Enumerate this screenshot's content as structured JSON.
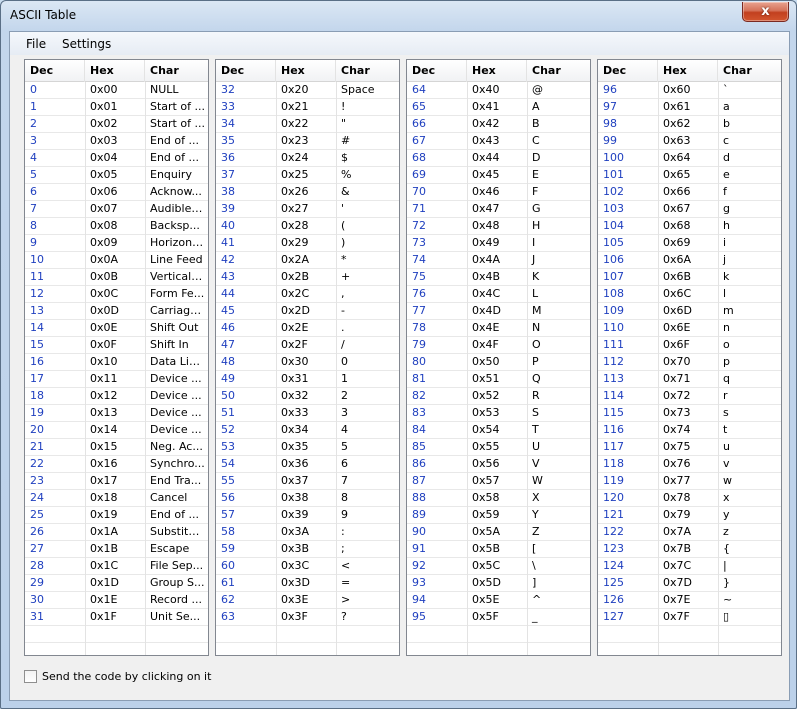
{
  "window": {
    "title": "ASCII Table",
    "close_label": "x"
  },
  "menu": [
    "File",
    "Settings"
  ],
  "columns": [
    "Dec",
    "Hex",
    "Char"
  ],
  "tables": [
    {
      "rows": [
        [
          "0",
          "0x00",
          "NULL"
        ],
        [
          "1",
          "0x01",
          "Start of ..."
        ],
        [
          "2",
          "0x02",
          "Start of ..."
        ],
        [
          "3",
          "0x03",
          "End of ..."
        ],
        [
          "4",
          "0x04",
          "End of ..."
        ],
        [
          "5",
          "0x05",
          "Enquiry"
        ],
        [
          "6",
          "0x06",
          "Acknow..."
        ],
        [
          "7",
          "0x07",
          "Audible ..."
        ],
        [
          "8",
          "0x08",
          "Backsp..."
        ],
        [
          "9",
          "0x09",
          "Horizont..."
        ],
        [
          "10",
          "0x0A",
          "Line Feed"
        ],
        [
          "11",
          "0x0B",
          "Vertical ..."
        ],
        [
          "12",
          "0x0C",
          "Form Fe..."
        ],
        [
          "13",
          "0x0D",
          "Carriage..."
        ],
        [
          "14",
          "0x0E",
          "Shift Out"
        ],
        [
          "15",
          "0x0F",
          "Shift In"
        ],
        [
          "16",
          "0x10",
          "Data Lin..."
        ],
        [
          "17",
          "0x11",
          "Device ..."
        ],
        [
          "18",
          "0x12",
          "Device ..."
        ],
        [
          "19",
          "0x13",
          "Device ..."
        ],
        [
          "20",
          "0x14",
          "Device ..."
        ],
        [
          "21",
          "0x15",
          "Neg. Ac..."
        ],
        [
          "22",
          "0x16",
          "Synchro..."
        ],
        [
          "23",
          "0x17",
          "End Tra..."
        ],
        [
          "24",
          "0x18",
          "Cancel"
        ],
        [
          "25",
          "0x19",
          "End of ..."
        ],
        [
          "26",
          "0x1A",
          "Substitu..."
        ],
        [
          "27",
          "0x1B",
          "Escape"
        ],
        [
          "28",
          "0x1C",
          "File Sep..."
        ],
        [
          "29",
          "0x1D",
          "Group S..."
        ],
        [
          "30",
          "0x1E",
          "Record ..."
        ],
        [
          "31",
          "0x1F",
          "Unit Se..."
        ]
      ]
    },
    {
      "rows": [
        [
          "32",
          "0x20",
          "Space"
        ],
        [
          "33",
          "0x21",
          "!"
        ],
        [
          "34",
          "0x22",
          "\""
        ],
        [
          "35",
          "0x23",
          "#"
        ],
        [
          "36",
          "0x24",
          "$"
        ],
        [
          "37",
          "0x25",
          "%"
        ],
        [
          "38",
          "0x26",
          "&"
        ],
        [
          "39",
          "0x27",
          "'"
        ],
        [
          "40",
          "0x28",
          "("
        ],
        [
          "41",
          "0x29",
          ")"
        ],
        [
          "42",
          "0x2A",
          "*"
        ],
        [
          "43",
          "0x2B",
          "+"
        ],
        [
          "44",
          "0x2C",
          ","
        ],
        [
          "45",
          "0x2D",
          "-"
        ],
        [
          "46",
          "0x2E",
          "."
        ],
        [
          "47",
          "0x2F",
          "/"
        ],
        [
          "48",
          "0x30",
          "0"
        ],
        [
          "49",
          "0x31",
          "1"
        ],
        [
          "50",
          "0x32",
          "2"
        ],
        [
          "51",
          "0x33",
          "3"
        ],
        [
          "52",
          "0x34",
          "4"
        ],
        [
          "53",
          "0x35",
          "5"
        ],
        [
          "54",
          "0x36",
          "6"
        ],
        [
          "55",
          "0x37",
          "7"
        ],
        [
          "56",
          "0x38",
          "8"
        ],
        [
          "57",
          "0x39",
          "9"
        ],
        [
          "58",
          "0x3A",
          ":"
        ],
        [
          "59",
          "0x3B",
          ";"
        ],
        [
          "60",
          "0x3C",
          "<"
        ],
        [
          "61",
          "0x3D",
          "="
        ],
        [
          "62",
          "0x3E",
          ">"
        ],
        [
          "63",
          "0x3F",
          "?"
        ]
      ]
    },
    {
      "rows": [
        [
          "64",
          "0x40",
          "@"
        ],
        [
          "65",
          "0x41",
          "A"
        ],
        [
          "66",
          "0x42",
          "B"
        ],
        [
          "67",
          "0x43",
          "C"
        ],
        [
          "68",
          "0x44",
          "D"
        ],
        [
          "69",
          "0x45",
          "E"
        ],
        [
          "70",
          "0x46",
          "F"
        ],
        [
          "71",
          "0x47",
          "G"
        ],
        [
          "72",
          "0x48",
          "H"
        ],
        [
          "73",
          "0x49",
          "I"
        ],
        [
          "74",
          "0x4A",
          "J"
        ],
        [
          "75",
          "0x4B",
          "K"
        ],
        [
          "76",
          "0x4C",
          "L"
        ],
        [
          "77",
          "0x4D",
          "M"
        ],
        [
          "78",
          "0x4E",
          "N"
        ],
        [
          "79",
          "0x4F",
          "O"
        ],
        [
          "80",
          "0x50",
          "P"
        ],
        [
          "81",
          "0x51",
          "Q"
        ],
        [
          "82",
          "0x52",
          "R"
        ],
        [
          "83",
          "0x53",
          "S"
        ],
        [
          "84",
          "0x54",
          "T"
        ],
        [
          "85",
          "0x55",
          "U"
        ],
        [
          "86",
          "0x56",
          "V"
        ],
        [
          "87",
          "0x57",
          "W"
        ],
        [
          "88",
          "0x58",
          "X"
        ],
        [
          "89",
          "0x59",
          "Y"
        ],
        [
          "90",
          "0x5A",
          "Z"
        ],
        [
          "91",
          "0x5B",
          "["
        ],
        [
          "92",
          "0x5C",
          "\\"
        ],
        [
          "93",
          "0x5D",
          "]"
        ],
        [
          "94",
          "0x5E",
          "^"
        ],
        [
          "95",
          "0x5F",
          "_"
        ]
      ]
    },
    {
      "rows": [
        [
          "96",
          "0x60",
          "`"
        ],
        [
          "97",
          "0x61",
          "a"
        ],
        [
          "98",
          "0x62",
          "b"
        ],
        [
          "99",
          "0x63",
          "c"
        ],
        [
          "100",
          "0x64",
          "d"
        ],
        [
          "101",
          "0x65",
          "e"
        ],
        [
          "102",
          "0x66",
          "f"
        ],
        [
          "103",
          "0x67",
          "g"
        ],
        [
          "104",
          "0x68",
          "h"
        ],
        [
          "105",
          "0x69",
          "i"
        ],
        [
          "106",
          "0x6A",
          "j"
        ],
        [
          "107",
          "0x6B",
          "k"
        ],
        [
          "108",
          "0x6C",
          "l"
        ],
        [
          "109",
          "0x6D",
          "m"
        ],
        [
          "110",
          "0x6E",
          "n"
        ],
        [
          "111",
          "0x6F",
          "o"
        ],
        [
          "112",
          "0x70",
          "p"
        ],
        [
          "113",
          "0x71",
          "q"
        ],
        [
          "114",
          "0x72",
          "r"
        ],
        [
          "115",
          "0x73",
          "s"
        ],
        [
          "116",
          "0x74",
          "t"
        ],
        [
          "117",
          "0x75",
          "u"
        ],
        [
          "118",
          "0x76",
          "v"
        ],
        [
          "119",
          "0x77",
          "w"
        ],
        [
          "120",
          "0x78",
          "x"
        ],
        [
          "121",
          "0x79",
          "y"
        ],
        [
          "122",
          "0x7A",
          "z"
        ],
        [
          "123",
          "0x7B",
          "{"
        ],
        [
          "124",
          "0x7C",
          "|"
        ],
        [
          "125",
          "0x7D",
          "}"
        ],
        [
          "126",
          "0x7E",
          "~"
        ],
        [
          "127",
          "0x7F",
          "▯"
        ]
      ]
    }
  ],
  "footer": {
    "checkbox_label": "Send the code by clicking on it",
    "checked": false
  },
  "colors": {
    "dec_text": "#1f3fbf",
    "close_button": "#c2401f"
  }
}
